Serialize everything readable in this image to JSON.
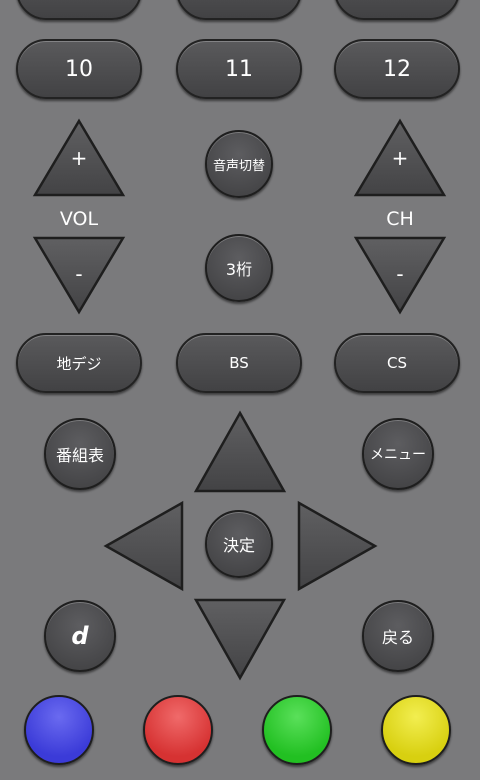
{
  "numbers": {
    "b10": "10",
    "b11": "11",
    "b12": "12"
  },
  "vol": {
    "label": "VOL",
    "up": "+",
    "down": "-"
  },
  "ch": {
    "label": "CH",
    "up": "+",
    "down": "-"
  },
  "center": {
    "audio_switch": "音声切替",
    "three_digit": "3桁",
    "ok": "決定"
  },
  "bands": {
    "terrestrial": "地デジ",
    "bs": "BS",
    "cs": "CS"
  },
  "nav": {
    "epg": "番組表",
    "menu": "メニュー",
    "d": "d",
    "back": "戻る"
  },
  "colors": {
    "blue": "#3b3bd8",
    "red": "#d63232",
    "green": "#22c022",
    "yellow": "#d8d010"
  }
}
